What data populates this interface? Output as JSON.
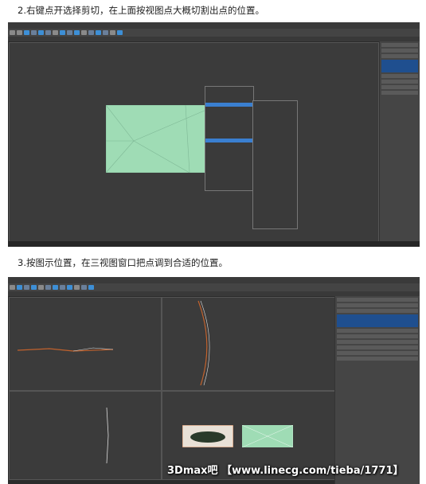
{
  "step2": "2.右键点开选择剪切，在上面按视图点大概切割出点的位置。",
  "step3": "3.按图示位置，在三视图窗口把点调到合适的位置。",
  "watermark": "3Dmax吧 【www.linecg.com/tieba/1771】",
  "colors": {
    "mesh": "#9fdcb5",
    "highlight": "#3a7fd0",
    "spline": "#c2622d"
  }
}
